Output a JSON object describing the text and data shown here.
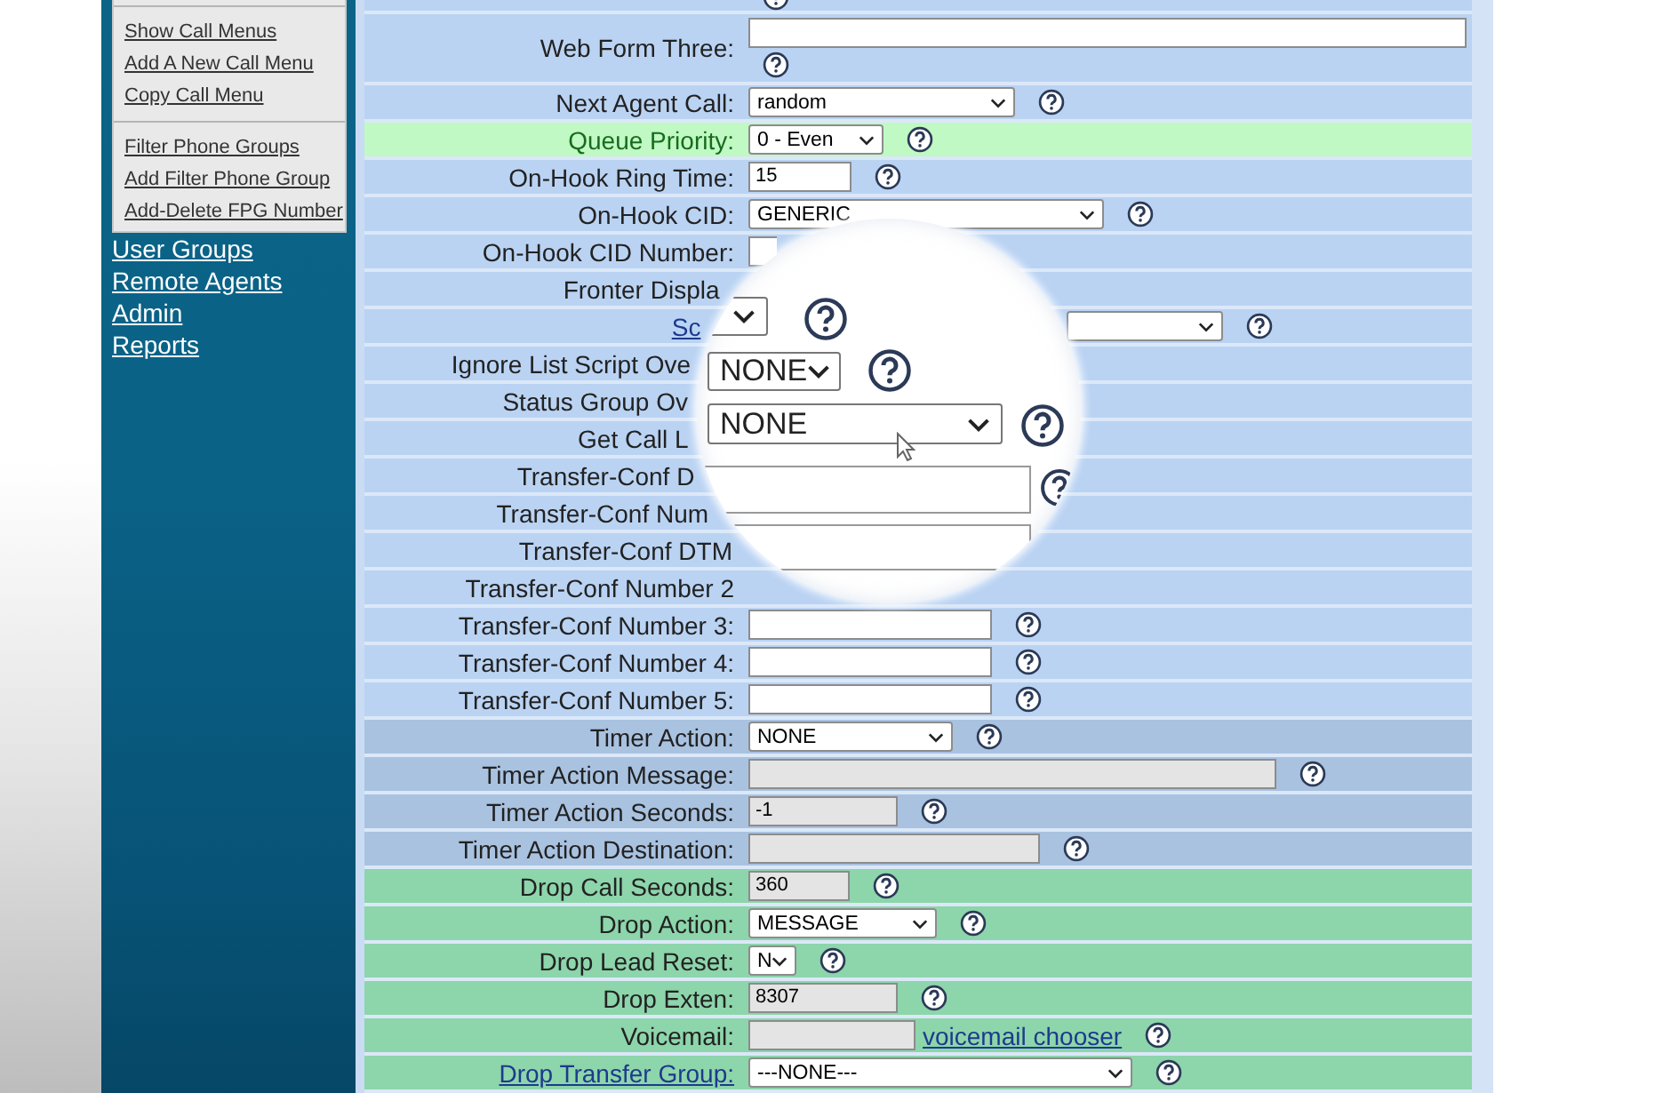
{
  "sidebar": {
    "submenu_groups": [
      {
        "items": [
          "Show Call Menus",
          "Add A New Call Menu",
          "Copy Call Menu"
        ]
      },
      {
        "items": [
          "Filter Phone Groups",
          "Add Filter Phone Group",
          "Add-Delete FPG Number"
        ]
      }
    ],
    "links": [
      "User Groups",
      "Remote Agents",
      "Admin",
      "Reports"
    ]
  },
  "form": {
    "rows": [
      {
        "kind": "cut",
        "color": "#bad3f3",
        "help": true
      },
      {
        "kind": "stacked",
        "color": "#bad3f3",
        "label": {
          "kind": "plain",
          "text": "Web Form Three:"
        },
        "control": {
          "kind": "input"
        },
        "help": true
      },
      {
        "kind": "inline",
        "color": "#bad3f3",
        "label": {
          "kind": "plain",
          "text": "Next Agent Call:"
        },
        "control": {
          "kind": "select",
          "value": "random"
        },
        "help": true
      },
      {
        "kind": "inline",
        "color": "#c0f9c3",
        "label": {
          "kind": "highlight",
          "text": "Queue Priority:"
        },
        "control": {
          "kind": "select",
          "value": "0 - Even"
        },
        "help": true
      },
      {
        "kind": "inline",
        "color": "#bad3f3",
        "label": {
          "kind": "plain",
          "text": "On-Hook Ring Time:"
        },
        "control": {
          "kind": "input",
          "value": "15"
        },
        "help": true
      },
      {
        "kind": "inline",
        "color": "#bad3f3",
        "label": {
          "kind": "plain",
          "text": "On-Hook CID:"
        },
        "control": {
          "kind": "select",
          "value": "GENERIC"
        },
        "help": true
      },
      {
        "kind": "inline",
        "color": "#bad3f3",
        "label": {
          "kind": "plain",
          "text": "On-Hook CID Number:"
        },
        "control": {
          "kind": "input"
        },
        "help": false
      },
      {
        "kind": "inline",
        "color": "#bad3f3",
        "label": {
          "kind": "plain",
          "text": "Fronter Displa"
        },
        "help": false
      },
      {
        "kind": "inline",
        "color": "#bad3f3",
        "label": {
          "kind": "link",
          "text": "Sc"
        },
        "control": {
          "kind": "select"
        },
        "help": true
      },
      {
        "kind": "inline",
        "color": "#bad3f3",
        "label": {
          "kind": "plain",
          "text": "Ignore List Script Ove"
        },
        "help": false
      },
      {
        "kind": "inline",
        "color": "#bad3f3",
        "label": {
          "kind": "plain",
          "text": "Status Group Ov"
        },
        "help": false
      },
      {
        "kind": "inline",
        "color": "#bad3f3",
        "label": {
          "kind": "plain",
          "text": "Get Call L"
        },
        "help": false
      },
      {
        "kind": "inline",
        "color": "#bad3f3",
        "label": {
          "kind": "plain",
          "text": "Transfer-Conf D"
        },
        "help": false
      },
      {
        "kind": "inline",
        "color": "#bad3f3",
        "label": {
          "kind": "plain",
          "text": "Transfer-Conf Num"
        },
        "help": false
      },
      {
        "kind": "inline",
        "color": "#bad3f3",
        "label": {
          "kind": "plain",
          "text": "Transfer-Conf DTM"
        },
        "help": false
      },
      {
        "kind": "inline",
        "color": "#bad3f3",
        "label": {
          "kind": "plain",
          "text": "Transfer-Conf Number 2"
        },
        "help": false
      },
      {
        "kind": "inline",
        "color": "#bad3f3",
        "label": {
          "kind": "plain",
          "text": "Transfer-Conf Number 3:"
        },
        "control": {
          "kind": "input"
        },
        "help": true
      },
      {
        "kind": "inline",
        "color": "#bad3f3",
        "label": {
          "kind": "plain",
          "text": "Transfer-Conf Number 4:"
        },
        "control": {
          "kind": "input"
        },
        "help": true
      },
      {
        "kind": "inline",
        "color": "#bad3f3",
        "label": {
          "kind": "plain",
          "text": "Transfer-Conf Number 5:"
        },
        "control": {
          "kind": "input"
        },
        "help": true
      },
      {
        "kind": "inline",
        "color": "#a9c2e0",
        "label": {
          "kind": "plain",
          "text": "Timer Action:"
        },
        "control": {
          "kind": "select",
          "value": "NONE"
        },
        "help": true
      },
      {
        "kind": "inline",
        "color": "#a9c2e0",
        "label": {
          "kind": "plain",
          "text": "Timer Action Message:"
        },
        "control": {
          "kind": "shaded-input"
        },
        "help": true
      },
      {
        "kind": "inline",
        "color": "#a9c2e0",
        "label": {
          "kind": "plain",
          "text": "Timer Action Seconds:"
        },
        "control": {
          "kind": "shaded-input",
          "value": "-1"
        },
        "help": true
      },
      {
        "kind": "inline",
        "color": "#a9c2e0",
        "label": {
          "kind": "plain",
          "text": "Timer Action Destination:"
        },
        "control": {
          "kind": "shaded-input"
        },
        "help": true
      },
      {
        "kind": "inline",
        "color": "#8dd5ab",
        "label": {
          "kind": "plain",
          "text": "Drop Call Seconds:"
        },
        "control": {
          "kind": "shaded-input",
          "value": "360"
        },
        "help": true
      },
      {
        "kind": "inline",
        "color": "#8dd5ab",
        "label": {
          "kind": "plain",
          "text": "Drop Action:"
        },
        "control": {
          "kind": "select",
          "value": "MESSAGE"
        },
        "help": true
      },
      {
        "kind": "inline",
        "color": "#8dd5ab",
        "label": {
          "kind": "plain",
          "text": "Drop Lead Reset:"
        },
        "control": {
          "kind": "select",
          "value": "N"
        },
        "help": true
      },
      {
        "kind": "inline",
        "color": "#8dd5ab",
        "label": {
          "kind": "plain",
          "text": "Drop Exten:"
        },
        "control": {
          "kind": "shaded-input",
          "value": "8307"
        },
        "help": true
      },
      {
        "kind": "inline",
        "color": "#8dd5ab",
        "label": {
          "kind": "plain",
          "text": "Voicemail:"
        },
        "control": {
          "kind": "shaded-input"
        },
        "chooser_link": "voicemail chooser",
        "help": true
      },
      {
        "kind": "inline",
        "color": "#8dd5ab",
        "label": {
          "kind": "link",
          "text": "Drop Transfer Group:"
        },
        "control": {
          "kind": "select",
          "value": "---NONE---"
        },
        "help": true
      }
    ]
  },
  "magnifier": {
    "items": [
      {
        "kind": "select"
      },
      {
        "kind": "help"
      },
      {
        "kind": "select",
        "value": "NONE"
      },
      {
        "kind": "help"
      },
      {
        "kind": "select",
        "value": "NONE"
      },
      {
        "kind": "help"
      },
      {
        "kind": "cursor"
      },
      {
        "kind": "input"
      },
      {
        "kind": "help"
      },
      {
        "kind": "input"
      }
    ]
  }
}
